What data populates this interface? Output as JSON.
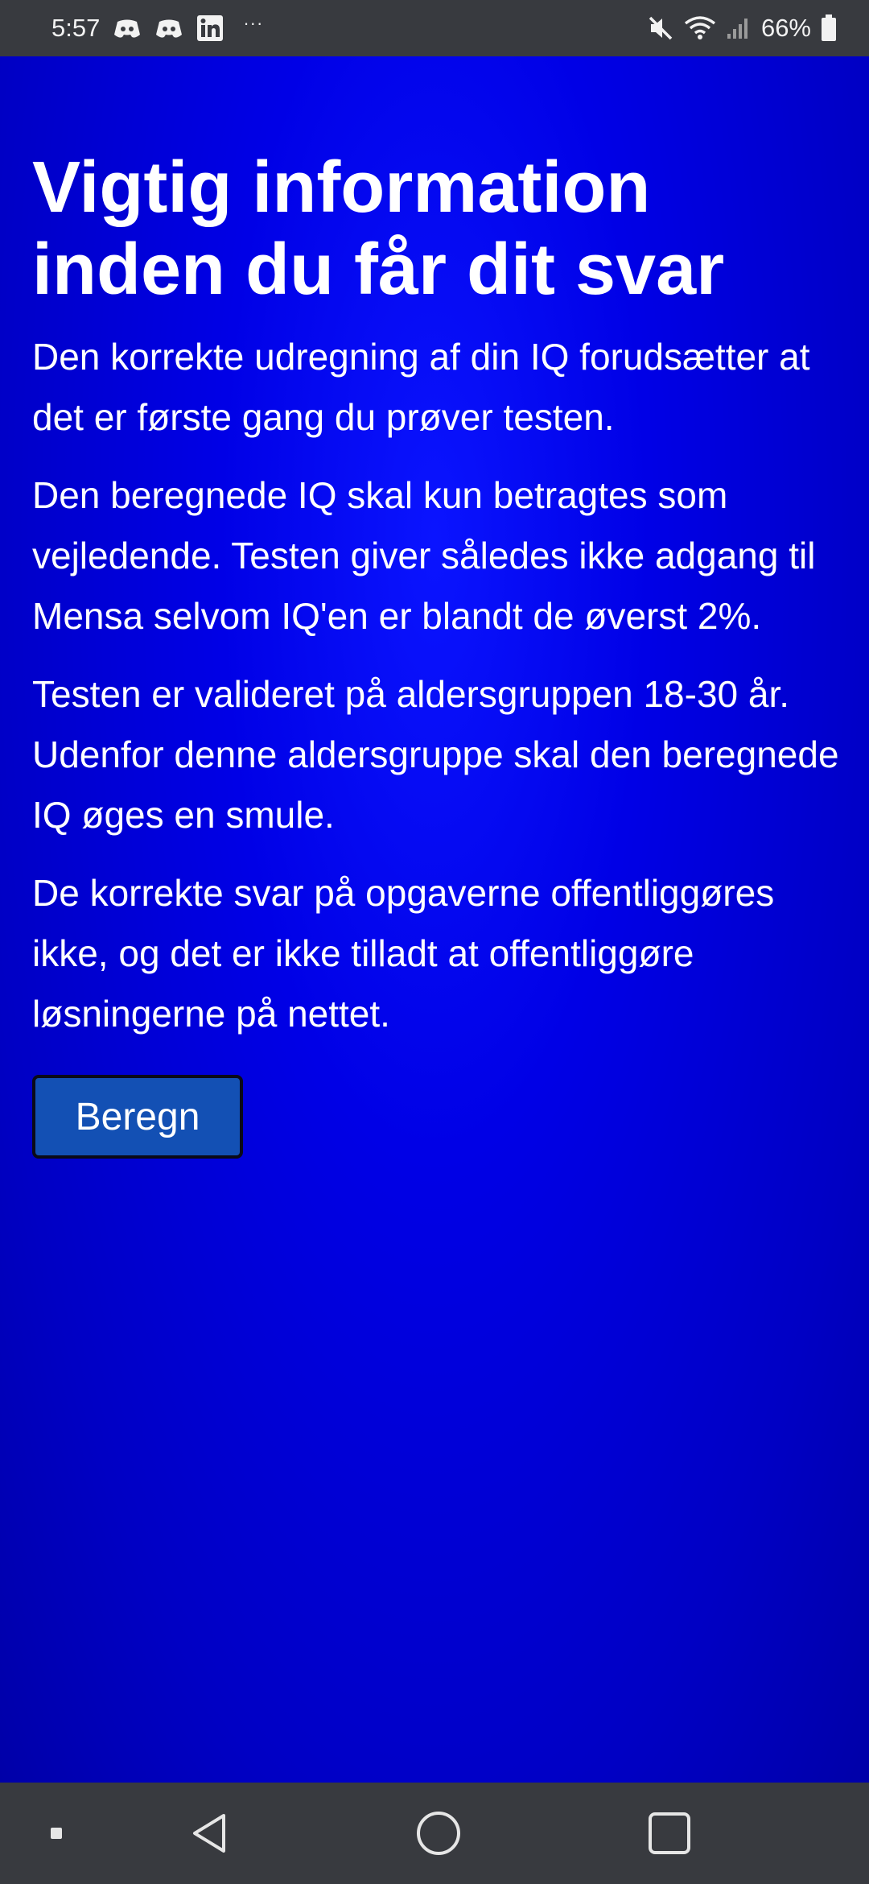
{
  "status_bar": {
    "time": "5:57",
    "battery_percent": "66%",
    "icons": [
      "discord-icon",
      "discord-icon",
      "linkedin-icon",
      "more-notifications-icon",
      "mute-icon",
      "wifi-icon",
      "signal-icon",
      "battery-icon"
    ]
  },
  "page": {
    "title": "Vigtig information inden du får dit svar",
    "paragraphs": [
      "Den korrekte udregning af din IQ forudsætter at det er første gang du prøver testen.",
      "Den beregnede IQ skal kun betragtes som vejledende. Testen giver således ikke adgang til Mensa selvom IQ'en er blandt de øverst 2%.",
      "Testen er valideret på aldersgruppen 18-30 år. Udenfor denne aldersgruppe skal den beregnede IQ øges en smule.",
      "De korrekte svar på opgaverne offentliggøres ikke, og det er ikke tilladt at offentliggøre løsningerne på nettet."
    ],
    "button_label": "Beregn"
  },
  "nav_bar": {
    "items": [
      "recents-dot-icon",
      "back-icon",
      "home-icon",
      "overview-icon"
    ]
  },
  "colors": {
    "background": "#0000e0",
    "button": "#1350b4",
    "system_bars": "#383a3f",
    "text": "#ffffff"
  }
}
